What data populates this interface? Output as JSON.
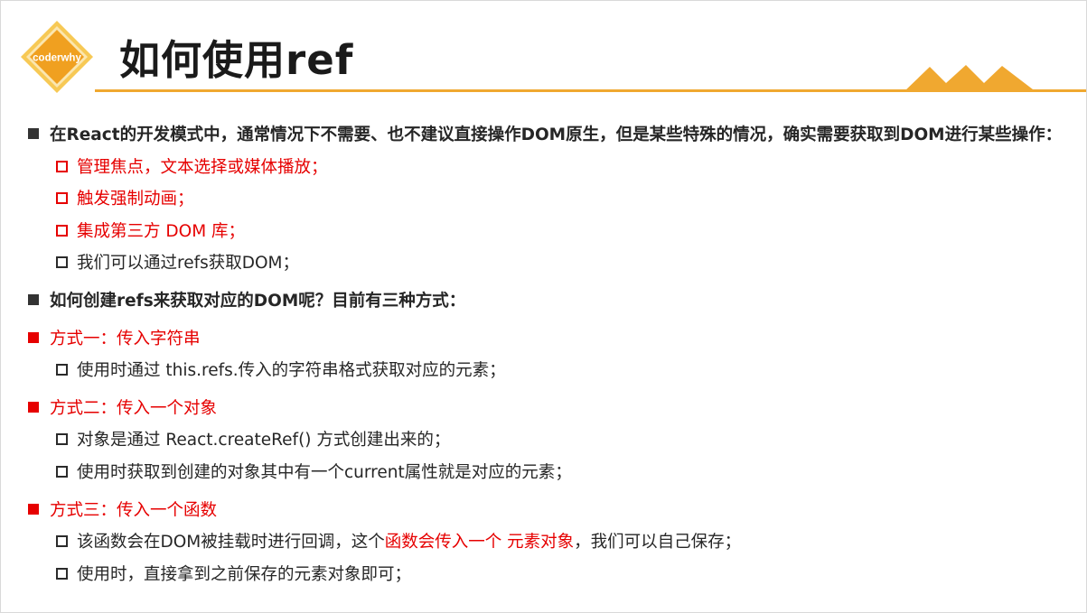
{
  "logo": {
    "text": "coderwhy",
    "colors": {
      "outer": "#f6c14e",
      "inner": "#f0a020"
    }
  },
  "title": "如何使用ref",
  "accent": "#f0a830",
  "items": [
    {
      "text": "在React的开发模式中，通常情况下不需要、也不建议直接操作DOM原生，但是某些特殊的情况，确实需要获取到DOM进行某些操作："
    },
    {
      "text": "管理焦点，文本选择或媒体播放；"
    },
    {
      "text": "触发强制动画；"
    },
    {
      "text": "集成第三方 DOM 库；"
    },
    {
      "text": "我们可以通过refs获取DOM；"
    },
    {
      "text": "如何创建refs来获取对应的DOM呢？目前有三种方式："
    },
    {
      "text": "方式一：传入字符串"
    },
    {
      "text": "使用时通过 this.refs.传入的字符串格式获取对应的元素；"
    },
    {
      "text": "方式二：传入一个对象"
    },
    {
      "text": "对象是通过 React.createRef() 方式创建出来的；"
    },
    {
      "text": "使用时获取到创建的对象其中有一个current属性就是对应的元素；"
    },
    {
      "text": "方式三：传入一个函数"
    },
    {
      "text_before": "该函数会在DOM被挂载时进行回调，这个",
      "text_highlight": "函数会传入一个 元素对象",
      "text_after": "，我们可以自己保存；"
    },
    {
      "text": "使用时，直接拿到之前保存的元素对象即可；"
    }
  ]
}
